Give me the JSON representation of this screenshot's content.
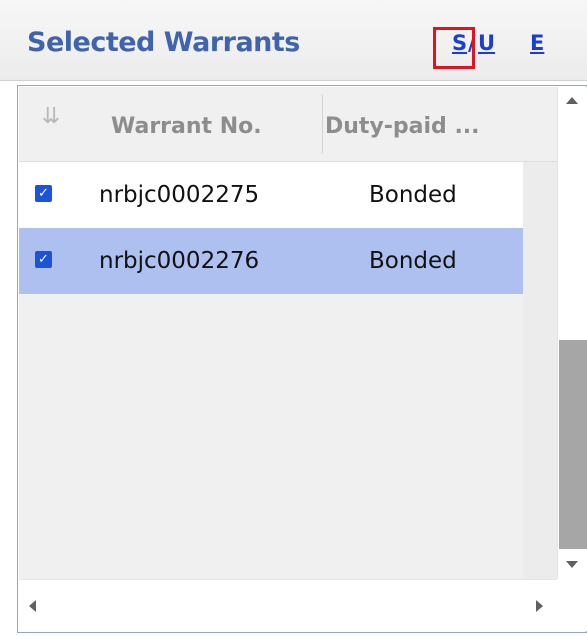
{
  "panel": {
    "title": "Selected Warrants",
    "links": {
      "s": "S",
      "sep": "/",
      "u": "U",
      "e": "E"
    }
  },
  "grid": {
    "header_icon": "double-chevron-down-icon",
    "columns": [
      "Warrant No.",
      "Duty-paid ..."
    ],
    "rows": [
      {
        "checked": true,
        "warrant_no": "nrbjc0002275",
        "duty_paid": "Bonded",
        "selected": false
      },
      {
        "checked": true,
        "warrant_no": "nrbjc0002276",
        "duty_paid": "Bonded",
        "selected": true
      }
    ]
  },
  "colors": {
    "title": "#3f63ad",
    "link": "#1b3fcc",
    "highlight_box": "#e0141e",
    "selected_row": "#aec0ef",
    "checkbox": "#1c54d6"
  }
}
